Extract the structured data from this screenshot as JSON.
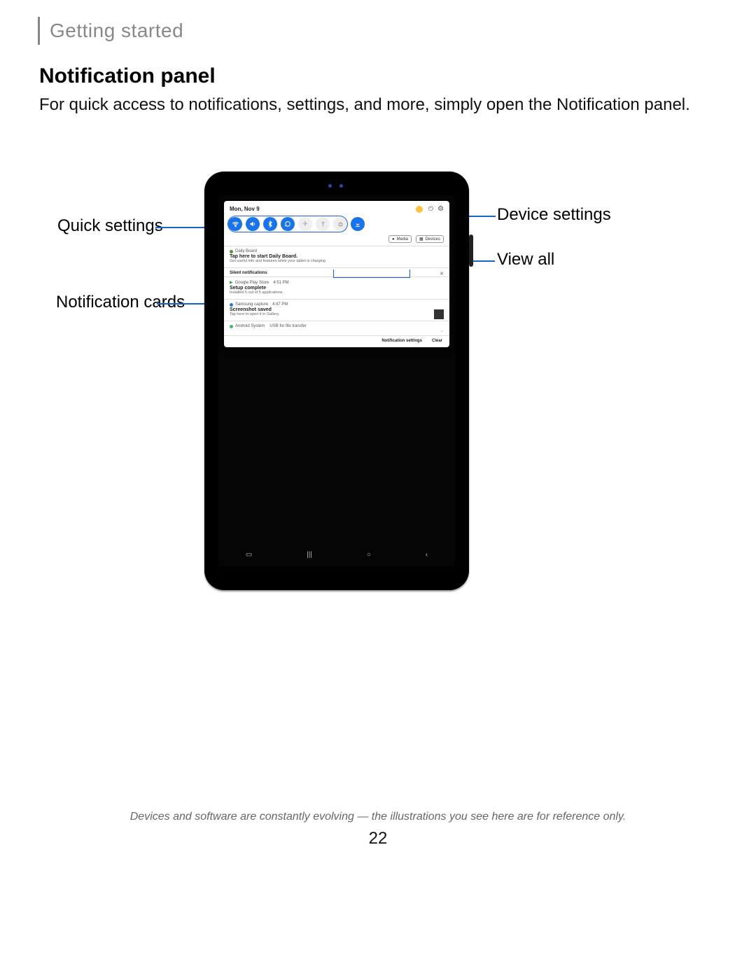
{
  "chapter": "Getting started",
  "section_title": "Notification panel",
  "section_desc": "For quick access to notifications, settings, and more, simply open the Notification panel.",
  "callouts": {
    "quick_settings": "Quick settings",
    "notification_cards": "Notification cards",
    "device_settings": "Device settings",
    "view_all": "View all"
  },
  "panel": {
    "date": "Mon, Nov 9",
    "media_chip": "Media",
    "devices_chip": "Devices",
    "cards": {
      "daily": {
        "app": "Daily Board",
        "title": "Tap here to start Daily Board.",
        "sub": "Get useful info and features while your tablet is charging"
      },
      "silent_header": "Silent notifications",
      "play": {
        "app": "Google Play Store",
        "time": "4:51 PM",
        "title": "Setup complete",
        "sub": "Installed 5 out of 5 applications"
      },
      "capture": {
        "app": "Samsung capture",
        "time": "4:47 PM",
        "title": "Screenshot saved",
        "sub": "Tap here to open it in Gallery."
      },
      "system": {
        "app": "Android System",
        "title": "USB for file transfer"
      }
    },
    "footer": {
      "settings": "Notification settings",
      "clear": "Clear"
    }
  },
  "footnote": "Devices and software are constantly evolving — the illustrations you see here are for reference only.",
  "page_number": "22"
}
